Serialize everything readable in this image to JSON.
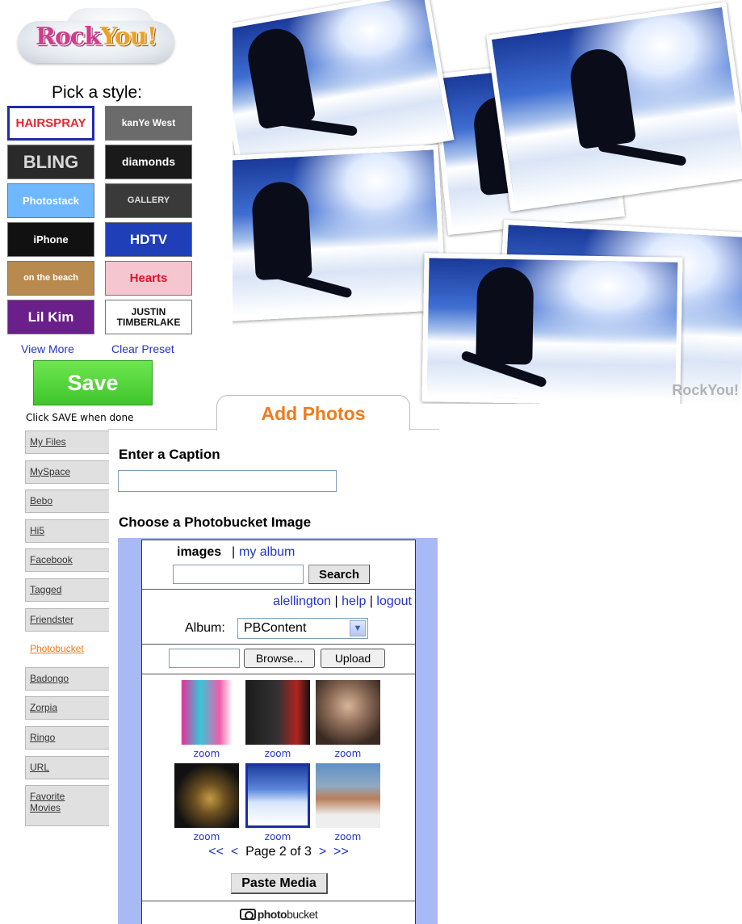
{
  "logo": {
    "text_main": "Rock",
    "text_accent": "You!"
  },
  "pick_title": "Pick a style:",
  "styles": [
    {
      "id": "hairspray",
      "label": "HAIRSPRAY",
      "bg": "#ffffff",
      "fg": "#e8262f",
      "selected": true
    },
    {
      "id": "kanye",
      "label": "kanYe West",
      "bg": "#6b6b6b",
      "fg": "#ffffff",
      "selected": false
    },
    {
      "id": "bling",
      "label": "BLING",
      "bg": "#2a2a2a",
      "fg": "#d8d8d8",
      "selected": false
    },
    {
      "id": "diamonds",
      "label": "diamonds",
      "bg": "#1a1a1a",
      "fg": "#ffffff",
      "selected": false
    },
    {
      "id": "photostack",
      "label": "Photostack",
      "bg": "#6fb8ff",
      "fg": "#ffffff",
      "selected": false
    },
    {
      "id": "gallery",
      "label": "GALLERY",
      "bg": "#3a3a3a",
      "fg": "#e0e0e0",
      "selected": false
    },
    {
      "id": "iphone",
      "label": "iPhone",
      "bg": "#111111",
      "fg": "#ffffff",
      "selected": false
    },
    {
      "id": "hdtv",
      "label": "HDTV",
      "bg": "#1e3fb8",
      "fg": "#ffffff",
      "selected": false
    },
    {
      "id": "beach",
      "label": "on the beach",
      "bg": "#b98a4e",
      "fg": "#ffffff",
      "selected": false
    },
    {
      "id": "hearts",
      "label": "Hearts",
      "bg": "#f5c6cf",
      "fg": "#e0122c",
      "selected": false
    },
    {
      "id": "lilkim",
      "label": "Lil Kim",
      "bg": "#6a1f8a",
      "fg": "#ffffff",
      "selected": false
    },
    {
      "id": "justin",
      "label": "JUSTIN TIMBERLAKE",
      "bg": "#ffffff",
      "fg": "#111111",
      "selected": false
    }
  ],
  "view_more": "View More",
  "clear_preset": "Clear Preset",
  "save_label": "Save",
  "save_hint": "Click SAVE when done",
  "collage": {
    "watermark": "RockYou!"
  },
  "add_photos_tab": "Add Photos",
  "sidebar": [
    {
      "label": "My Files",
      "active": false
    },
    {
      "label": "MySpace",
      "active": false
    },
    {
      "label": "Bebo",
      "active": false
    },
    {
      "label": "Hi5",
      "active": false
    },
    {
      "label": "Facebook",
      "active": false
    },
    {
      "label": "Tagged",
      "active": false
    },
    {
      "label": "Friendster",
      "active": false
    },
    {
      "label": "Photobucket",
      "active": true
    },
    {
      "label": "Badongo",
      "active": false
    },
    {
      "label": "Zorpia",
      "active": false
    },
    {
      "label": "Ringo",
      "active": false
    },
    {
      "label": "URL",
      "active": false
    },
    {
      "label": "Favorite Movies",
      "active": false
    }
  ],
  "caption_label": "Enter a Caption",
  "caption_value": "",
  "choose_label": "Choose a Photobucket Image",
  "photobucket": {
    "images_tab": "images",
    "divider": "|",
    "my_album_tab": "my album",
    "search_value": "",
    "search_button": "Search",
    "user": "alellington",
    "help": "help",
    "logout": "logout",
    "sep": "|",
    "album_label": "Album:",
    "album_selected": "PBContent",
    "browse_button": "Browse...",
    "upload_button": "Upload",
    "thumbs": [
      {
        "id": "feathers",
        "zoom": "zoom",
        "selected": false
      },
      {
        "id": "punk",
        "zoom": "zoom",
        "selected": false
      },
      {
        "id": "woman-glasses",
        "zoom": "zoom",
        "selected": false
      },
      {
        "id": "saxophone",
        "zoom": "zoom",
        "selected": false
      },
      {
        "id": "snowboarder",
        "zoom": "zoom",
        "selected": true
      },
      {
        "id": "snow-house",
        "zoom": "zoom",
        "selected": false
      }
    ],
    "pager": {
      "first": "<<",
      "prev": "<",
      "text": "Page 2 of 3",
      "next": ">",
      "last": ">>"
    },
    "paste_button": "Paste Media",
    "brand_a": "photo",
    "brand_b": "bucket"
  }
}
